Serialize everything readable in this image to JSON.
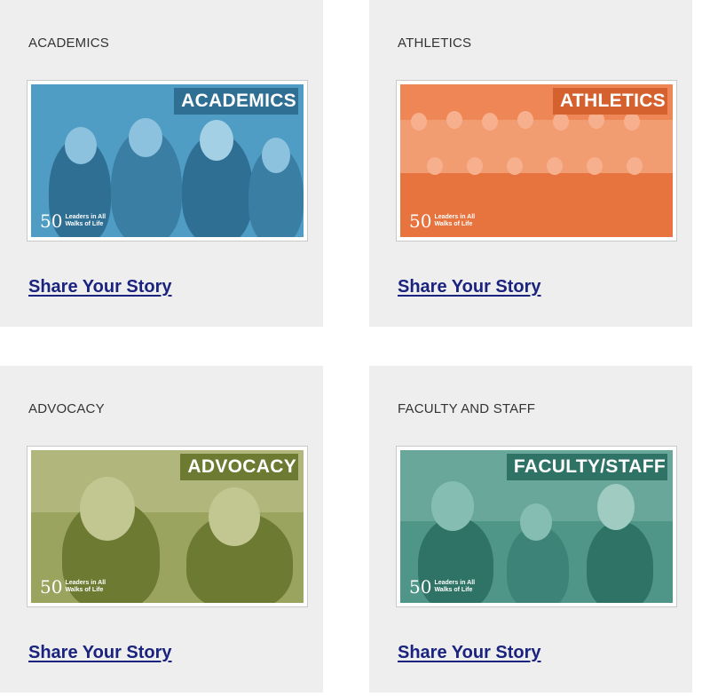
{
  "cards": [
    {
      "title": "ACADEMICS",
      "banner": "ACADEMICS",
      "link": "Share Your Story",
      "tint": "#4f9dc4",
      "dark": "#2f6f94",
      "light": "#8cc2de"
    },
    {
      "title": "ATHLETICS",
      "banner": "ATHLETICS",
      "link": "Share Your Story",
      "tint": "#ef8656",
      "dark": "#d5612f",
      "light": "#f7b08d"
    },
    {
      "title": "ADVOCACY",
      "banner": "ADVOCACY",
      "link": "Share Your Story",
      "tint": "#9aa45f",
      "dark": "#6d7a32",
      "light": "#c2c690"
    },
    {
      "title": "FACULTY AND STAFF",
      "banner": "FACULTY/STAFF",
      "link": "Share Your Story",
      "tint": "#4f9689",
      "dark": "#2e7366",
      "light": "#86bdb2"
    }
  ],
  "logo": {
    "number": "50",
    "line1": "Leaders in All",
    "line2": "Walks of Life"
  }
}
